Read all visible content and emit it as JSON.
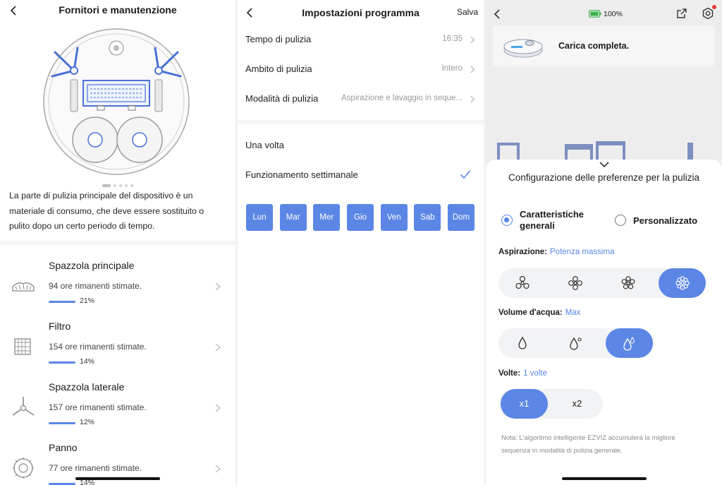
{
  "panel1": {
    "title": "Fornitori e manutenzione",
    "description": "La parte di pulizia principale del dispositivo è un materiale di consumo, che deve essere sostituito o pulito dopo un certo periodo di tempo.",
    "parts": [
      {
        "name": "Spazzola principale",
        "remaining": "94 ore rimanenti stimate.",
        "percent_label": "21%",
        "percent": 21,
        "icon": "main-brush-icon"
      },
      {
        "name": "Filtro",
        "remaining": "154 ore rimanenti stimate.",
        "percent_label": "14%",
        "percent": 14,
        "icon": "filter-icon"
      },
      {
        "name": "Spazzola laterale",
        "remaining": "157 ore rimanenti stimate.",
        "percent_label": "12%",
        "percent": 12,
        "icon": "side-brush-icon"
      },
      {
        "name": "Panno",
        "remaining": "77 ore rimanenti stimate.",
        "percent_label": "14%",
        "percent": 14,
        "icon": "mop-icon"
      }
    ]
  },
  "panel2": {
    "title": "Impostazioni programma",
    "save_label": "Salva",
    "rows": [
      {
        "label": "Tempo di pulizia",
        "value": "16:35"
      },
      {
        "label": "Ambito di pulizia",
        "value": "Intero"
      },
      {
        "label": "Modalità di pulizia",
        "value": "Aspirazione e lavaggio in seque..."
      }
    ],
    "once_label": "Una volta",
    "weekly_label": "Funzionamento settimanale",
    "days": [
      "Lun",
      "Mar",
      "Mer",
      "Gio",
      "Ven",
      "Sab",
      "Dom"
    ]
  },
  "panel3": {
    "battery": "100%",
    "banner_text": "Carica completa.",
    "sheet_title": "Configurazione delle preferenze per la pulizia",
    "option_general": "Caratteristiche generali",
    "option_custom": "Personalizzato",
    "suction_label": "Aspirazione:",
    "suction_value": "Potenza massima",
    "water_label": "Volume d'acqua:",
    "water_value": "Max",
    "times_label": "Volte:",
    "times_value": "1 volte",
    "times_options": [
      "x1",
      "x2"
    ],
    "note": "Nota: L'algoritmo intelligente EZVIZ accumulerà la migliore sequenza in modalità di pulizia generale."
  },
  "colors": {
    "accent": "#5b86e5",
    "badge": "#e33333",
    "battery": "#3cb34a"
  }
}
